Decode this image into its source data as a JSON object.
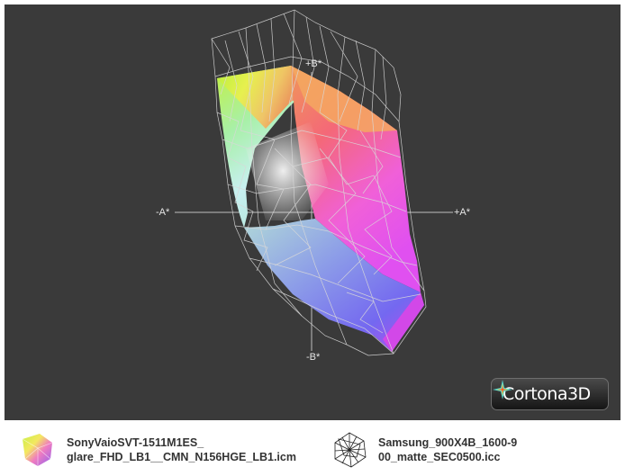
{
  "viewer": {
    "background": "#3a3a3a",
    "axes": {
      "b_plus": "+B*",
      "b_minus": "-B*",
      "a_minus": "-A*",
      "a_plus": "+A*"
    },
    "brand": {
      "name": "Cortona3D",
      "icon": "cortona-star-icon"
    }
  },
  "legend": {
    "items": [
      {
        "icon": "color-gamut-solid-icon",
        "line1": "SonyVaioSVT-1511M1ES_",
        "line2": "glare_FHD_LB1__CMN_N156HGE_LB1.icm"
      },
      {
        "icon": "wireframe-gamut-icon",
        "line1": "Samsung_900X4B_1600-9",
        "line2": "00_matte_SEC0500.icc"
      }
    ]
  }
}
